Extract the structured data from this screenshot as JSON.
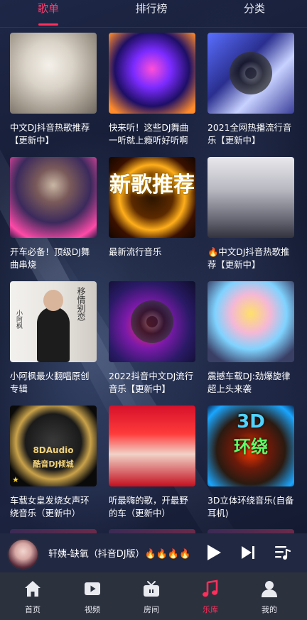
{
  "tabs": [
    {
      "label": "歌单",
      "active": true
    },
    {
      "label": "排行榜",
      "active": false
    },
    {
      "label": "分类",
      "active": false
    }
  ],
  "playlists": [
    {
      "title": "中文DJ抖音热歌推荐【更新中】"
    },
    {
      "title": "快来听！这些DJ舞曲一听就上瘾听好听啊"
    },
    {
      "title": "2021全网热播流行音乐【更新中】"
    },
    {
      "title": "开车必备！顶级DJ舞曲串烧"
    },
    {
      "title": "最新流行音乐",
      "cover_text": "新歌推荐"
    },
    {
      "title": "🔥中文DJ抖音热歌推荐【更新中】"
    },
    {
      "title": "小阿枫最火翻唱原创专辑",
      "cover_text": "移情别恋",
      "cover_name": "小阿枫"
    },
    {
      "title": "2022抖音中文DJ流行音乐【更新中】"
    },
    {
      "title": "震撼车载DJ:劲爆旋律超上头来袭"
    },
    {
      "title": "车载女皇发烧女声环绕音乐（更新中）",
      "cover_text": "8DAudio",
      "cover_sub": "酷音DJ倾城"
    },
    {
      "title": "听最嗨的歌，开最野的车（更新中）"
    },
    {
      "title": "3D立体环绕音乐(自备耳机)",
      "cover_text": "3D",
      "cover_sub": "环绕"
    }
  ],
  "player": {
    "song": "轩姨-缺氧（抖音DJ版）🔥🔥🔥🔥"
  },
  "nav": [
    {
      "label": "首页",
      "icon": "home-icon",
      "active": false
    },
    {
      "label": "视频",
      "icon": "video-icon",
      "active": false
    },
    {
      "label": "房间",
      "icon": "tv-room-icon",
      "active": false
    },
    {
      "label": "乐库",
      "icon": "music-note-icon",
      "active": true
    },
    {
      "label": "我的",
      "icon": "user-icon",
      "active": false
    }
  ],
  "colors": {
    "accent": "#ff2e5b",
    "nav_bg": "#2c313e",
    "player_bg": "#212842"
  }
}
